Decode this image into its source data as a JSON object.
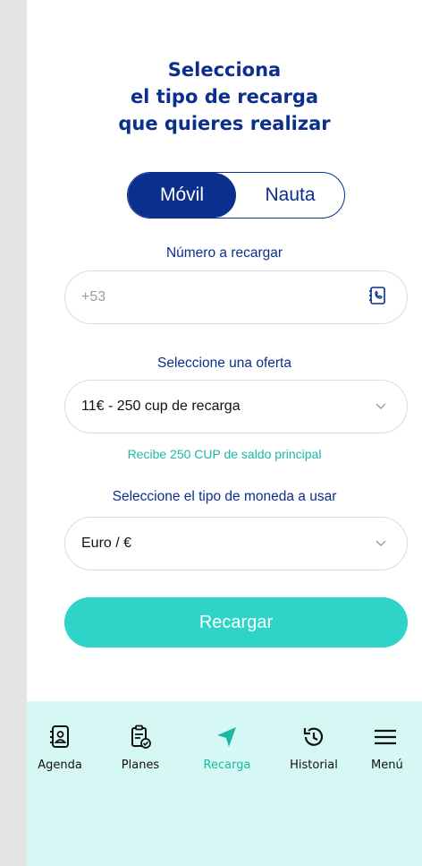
{
  "heading": {
    "line1": "Selecciona",
    "line2": "el tipo de recarga",
    "line3": "que quieres realizar"
  },
  "recharge_type": {
    "options": [
      "Móvil",
      "Nauta"
    ],
    "selected": "Móvil"
  },
  "phone": {
    "label": "Número a recargar",
    "placeholder": "+53",
    "value": ""
  },
  "offer": {
    "label": "Seleccione una oferta",
    "selected": "11€ - 250 cup de recarga",
    "hint": "Recibe 250 CUP de saldo principal"
  },
  "currency": {
    "label": "Seleccione el tipo de moneda a usar",
    "selected": "Euro / €"
  },
  "submit_label": "Recargar",
  "nav": {
    "items": [
      {
        "label": "Agenda",
        "icon": "contacts-book-icon"
      },
      {
        "label": "Planes",
        "icon": "clipboard-check-icon"
      },
      {
        "label": "Recarga",
        "icon": "send-arrow-icon"
      },
      {
        "label": "Historial",
        "icon": "history-icon"
      },
      {
        "label": "Menú",
        "icon": "menu-icon"
      }
    ],
    "active": "Recarga"
  },
  "colors": {
    "primary": "#0b2f8c",
    "accent": "#2ed4c8",
    "hint": "#1cb8a6",
    "nav_background": "#d6f8f5"
  }
}
